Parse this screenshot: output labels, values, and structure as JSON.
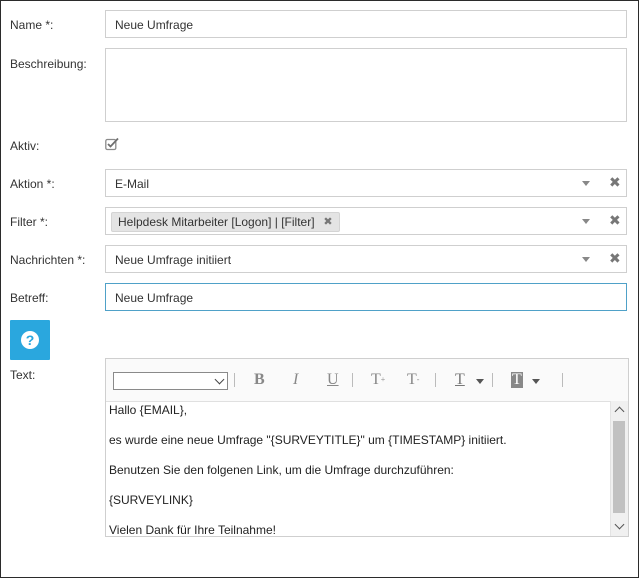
{
  "form": {
    "name_label": "Name *:",
    "name_value": "Neue Umfrage",
    "description_label": "Beschreibung:",
    "description_value": "",
    "active_label": "Aktiv:",
    "active_checked": true,
    "action_label": "Aktion *:",
    "action_value": "E-Mail",
    "filter_label": "Filter *:",
    "filter_tags": [
      "Helpdesk Mitarbeiter [Logon] | [Filter]"
    ],
    "messages_label": "Nachrichten *:",
    "messages_value": "Neue Umfrage initiiert",
    "subject_label": "Betreff:",
    "subject_value": "Neue Umfrage",
    "text_label": "Text:",
    "clear_symbol": "✖",
    "tag_remove_symbol": "✖"
  },
  "help": {
    "icon": "question-circle-icon",
    "symbol": "?"
  },
  "editor": {
    "font_select_value": "",
    "toolbar": {
      "bold": "B",
      "italic": "I",
      "underline": "U",
      "superscript": "T",
      "superscript_mark": "+",
      "subscript": "T",
      "subscript_mark": "-",
      "text_color": "T",
      "background_color": "T"
    },
    "content_lines": [
      "Hallo {EMAIL},",
      "es wurde eine neue Umfrage \"{SURVEYTITLE}\" um {TIMESTAMP} initiiert.",
      "Benutzen Sie den folgenen Link, um die Umfrage durchzuführen:",
      "{SURVEYLINK}",
      "Vielen Dank für Ihre Teilnahme!"
    ]
  },
  "colors": {
    "accent": "#2aa7de",
    "focus_border": "#4fa1c8",
    "field_border": "#cfcfcf"
  }
}
